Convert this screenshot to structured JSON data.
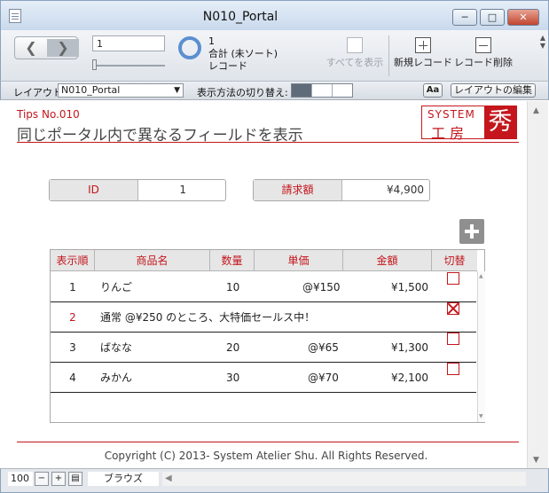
{
  "window": {
    "title": "N010_Portal"
  },
  "toolbar": {
    "record_input": "1",
    "record_count": "1",
    "record_sort": "合計 (未ソート)",
    "record_label": "レコード",
    "show_all": "すべてを表示",
    "new_record": "新規レコード",
    "delete_record": "レコード削除"
  },
  "statusbar": {
    "layout_label": "レイアウト:",
    "layout_value": "N010_Portal",
    "view_label": "表示方法の切り替え:",
    "aa": "Aa",
    "edit_layout": "レイアウトの編集"
  },
  "header": {
    "tips": "Tips No.010",
    "title": "同じポータル内で異なるフィールドを表示",
    "logo_top": "SYSTEM",
    "logo_bottom": "工房",
    "logo_mark": "秀"
  },
  "fields": {
    "id_label": "ID",
    "id_value": "1",
    "bill_label": "請求額",
    "bill_value": "¥4,900"
  },
  "portal": {
    "columns": [
      "表示順",
      "商品名",
      "数量",
      "単価",
      "金額",
      "切替"
    ],
    "rows": [
      {
        "order": "1",
        "name": "りんご",
        "qty": "10",
        "price": "@¥150",
        "amount": "¥1,500",
        "checked": false
      },
      {
        "order": "2",
        "note": "通常 @¥250 のところ、大特価セールス中！",
        "checked": true
      },
      {
        "order": "3",
        "name": "ばなな",
        "qty": "20",
        "price": "@¥65",
        "amount": "¥1,300",
        "checked": false
      },
      {
        "order": "4",
        "name": "みかん",
        "qty": "30",
        "price": "@¥70",
        "amount": "¥2,100",
        "checked": false
      }
    ]
  },
  "footer": {
    "copyright": "Copyright (C) 2013- System Atelier Shu. All Rights Reserved."
  },
  "bottombar": {
    "zoom": "100",
    "mode": "ブラウズ"
  }
}
